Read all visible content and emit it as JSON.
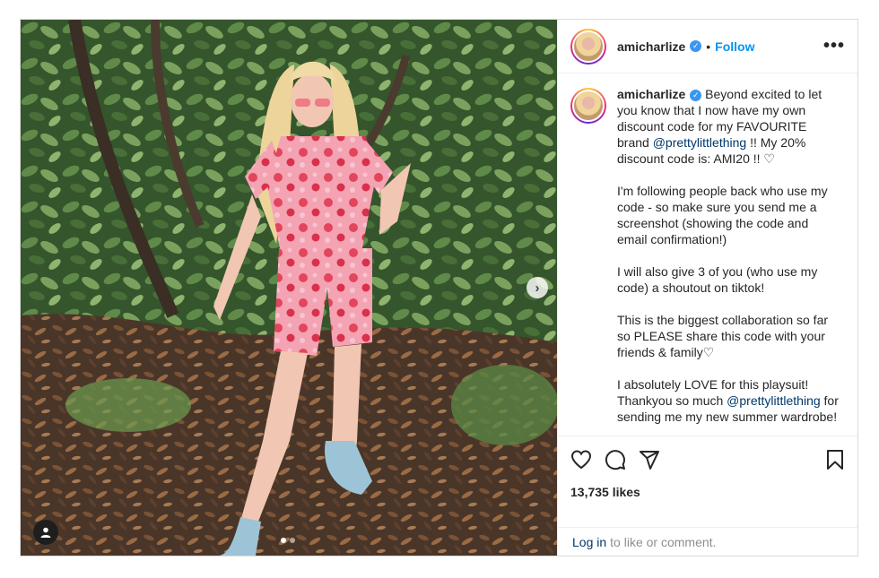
{
  "post": {
    "username": "amicharlize",
    "follow_label": "Follow",
    "separator": "•",
    "more_label": "•••",
    "caption_segments": [
      {
        "type": "user",
        "text": "amicharlize"
      },
      {
        "type": "text",
        "text": " Beyond excited to let you know that I now have my own discount code for my FAVOURITE brand "
      },
      {
        "type": "mention",
        "text": "@prettylittlething"
      },
      {
        "type": "text",
        "text": " !! My 20% discount code is: AMI20 !! ♡"
      }
    ],
    "caption_paragraphs": [
      "I'm following people back who use my code - so make sure you send me a screenshot (showing the code and email confirmation!)",
      "I will also give 3 of you (who use my code) a shoutout on tiktok!",
      "This is the biggest collaboration so far so PLEASE share this code with your friends & family♡"
    ],
    "last_paragraph": {
      "before": "I absolutely LOVE for this playsuit! Thankyou so much ",
      "mention": "@prettylittlething",
      "after": " for sending me my new summer wardrobe!"
    },
    "likes": "13,735 likes",
    "login_link": "Log in",
    "login_text": "to like or comment.",
    "carousel": {
      "slides": 2,
      "active": 1
    },
    "colors": {
      "link_blue": "#0095f6",
      "mention_blue": "#00376b",
      "verified_blue": "#3897f0",
      "border": "#dbdbdb"
    },
    "icons": [
      "verified-icon",
      "more-icon",
      "heart-icon",
      "comment-icon",
      "share-icon",
      "bookmark-icon",
      "next-arrow-icon",
      "user-tag-icon"
    ]
  }
}
